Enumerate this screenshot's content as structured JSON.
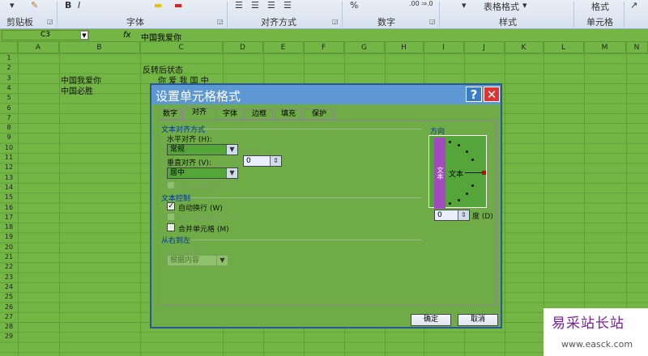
{
  "ribbon": {
    "groups": [
      "剪贴板",
      "字体",
      "对齐方式",
      "数字",
      "样式",
      "单元格"
    ],
    "table_format": "表格格式",
    "cell_format": "格式",
    "number_fmt": "%",
    "decimals": ".00 ⇒.0"
  },
  "formula": {
    "name_box": "C3",
    "fx": "fx",
    "content": "中国我爱你"
  },
  "columns": [
    "A",
    "B",
    "C",
    "D",
    "E",
    "F",
    "G",
    "H",
    "I",
    "J",
    "K",
    "L",
    "M",
    "N"
  ],
  "rows": [
    "1",
    "2",
    "3",
    "4",
    "5",
    "6",
    "7",
    "8",
    "9",
    "10",
    "11",
    "12",
    "13",
    "14",
    "15",
    "16",
    "17",
    "18",
    "19",
    "20",
    "21",
    "22",
    "23",
    "24",
    "25",
    "26",
    "27",
    "28",
    "29"
  ],
  "cells": {
    "c2": "反转后状态",
    "b3": "中国我爱你",
    "c3": "你 爱 我 国 中",
    "b4": "中国必胜"
  },
  "dialog": {
    "title": "设置单元格格式",
    "help": "?",
    "close": "✕",
    "tabs": [
      "数字",
      "对齐",
      "字体",
      "边框",
      "填充",
      "保护"
    ],
    "alignment_section": "文本对齐方式",
    "horizontal_label": "水平对齐 (H):",
    "horizontal_value": "常规",
    "indent_label": "缩进 (I):",
    "indent_value": "0",
    "vertical_label": "垂直对齐 (V):",
    "vertical_value": "居中",
    "justify_distributed": "两端分散对齐 (E)",
    "control_section": "文本控制",
    "wrap_text": "自动换行 (W)",
    "shrink_fit": "缩小字体填充 (K)",
    "merge_cells": "合并单元格 (M)",
    "rtl_section": "从右到左",
    "direction_label": "文字方向 (T):",
    "direction_value": "根据内容",
    "orientation_section": "方向",
    "vertical_text": "文本",
    "orient_text": "文本",
    "degree_value": "0",
    "degree_label": "度 (D)",
    "ok": "确定",
    "cancel": "取消"
  },
  "watermark": {
    "line1": "易采站长站",
    "line2": "www.easck.com"
  }
}
